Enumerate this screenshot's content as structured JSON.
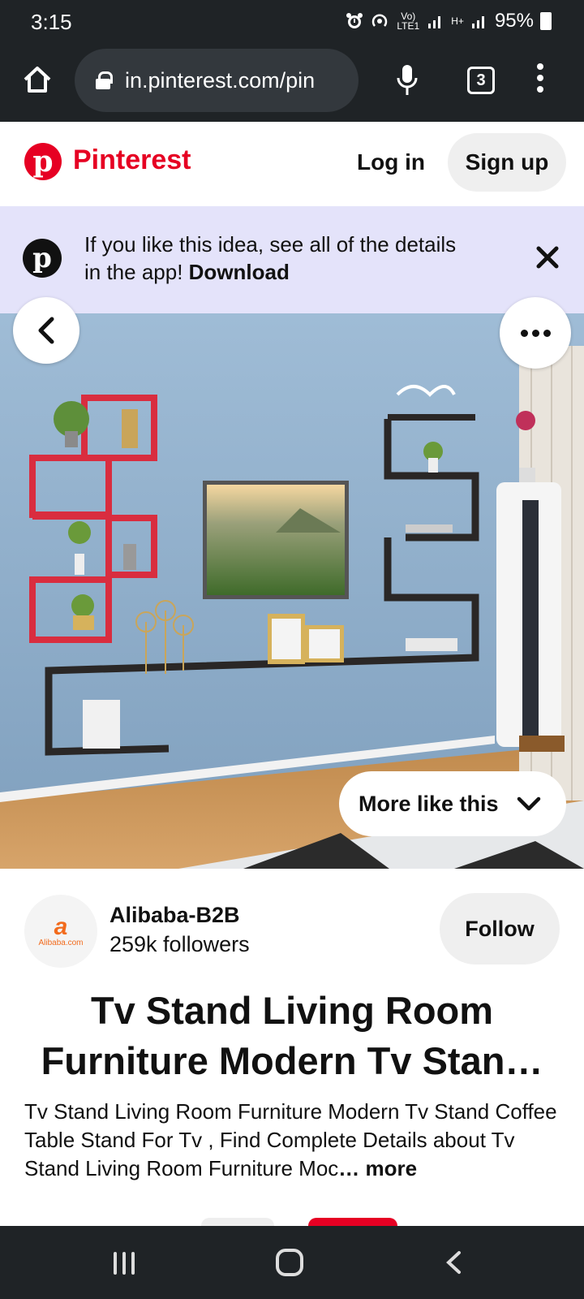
{
  "status_bar": {
    "time": "3:15",
    "network_label": "Vo) LTE1",
    "network2_label": "H+",
    "battery": "95%"
  },
  "browser": {
    "url": "in.pinterest.com/pin",
    "tab_count": "3"
  },
  "header": {
    "brand": "Pinterest",
    "login_label": "Log in",
    "signup_label": "Sign up"
  },
  "banner": {
    "text": "If you like this idea, see all of the details in the app! ",
    "link": "Download"
  },
  "image": {
    "more_like_label": "More like this"
  },
  "creator": {
    "name": "Alibaba-B2B",
    "followers": "259k followers",
    "avatar_text": "Alibaba.com",
    "follow_label": "Follow"
  },
  "pin": {
    "title": "Tv Stand Living Room Furniture Modern Tv Stan…",
    "description": "Tv Stand Living Room Furniture Modern Tv Stand Coffee Table Stand For Tv , Find Complete Details about Tv Stand Living Room Furniture Moc",
    "more_label": "… more"
  },
  "colors": {
    "pinterest_red": "#e60023",
    "banner_bg": "#e4e3fa",
    "wall_blue": "#8aa9c6",
    "shelf_red": "#d92d3f",
    "shelf_dark": "#2a2726"
  }
}
